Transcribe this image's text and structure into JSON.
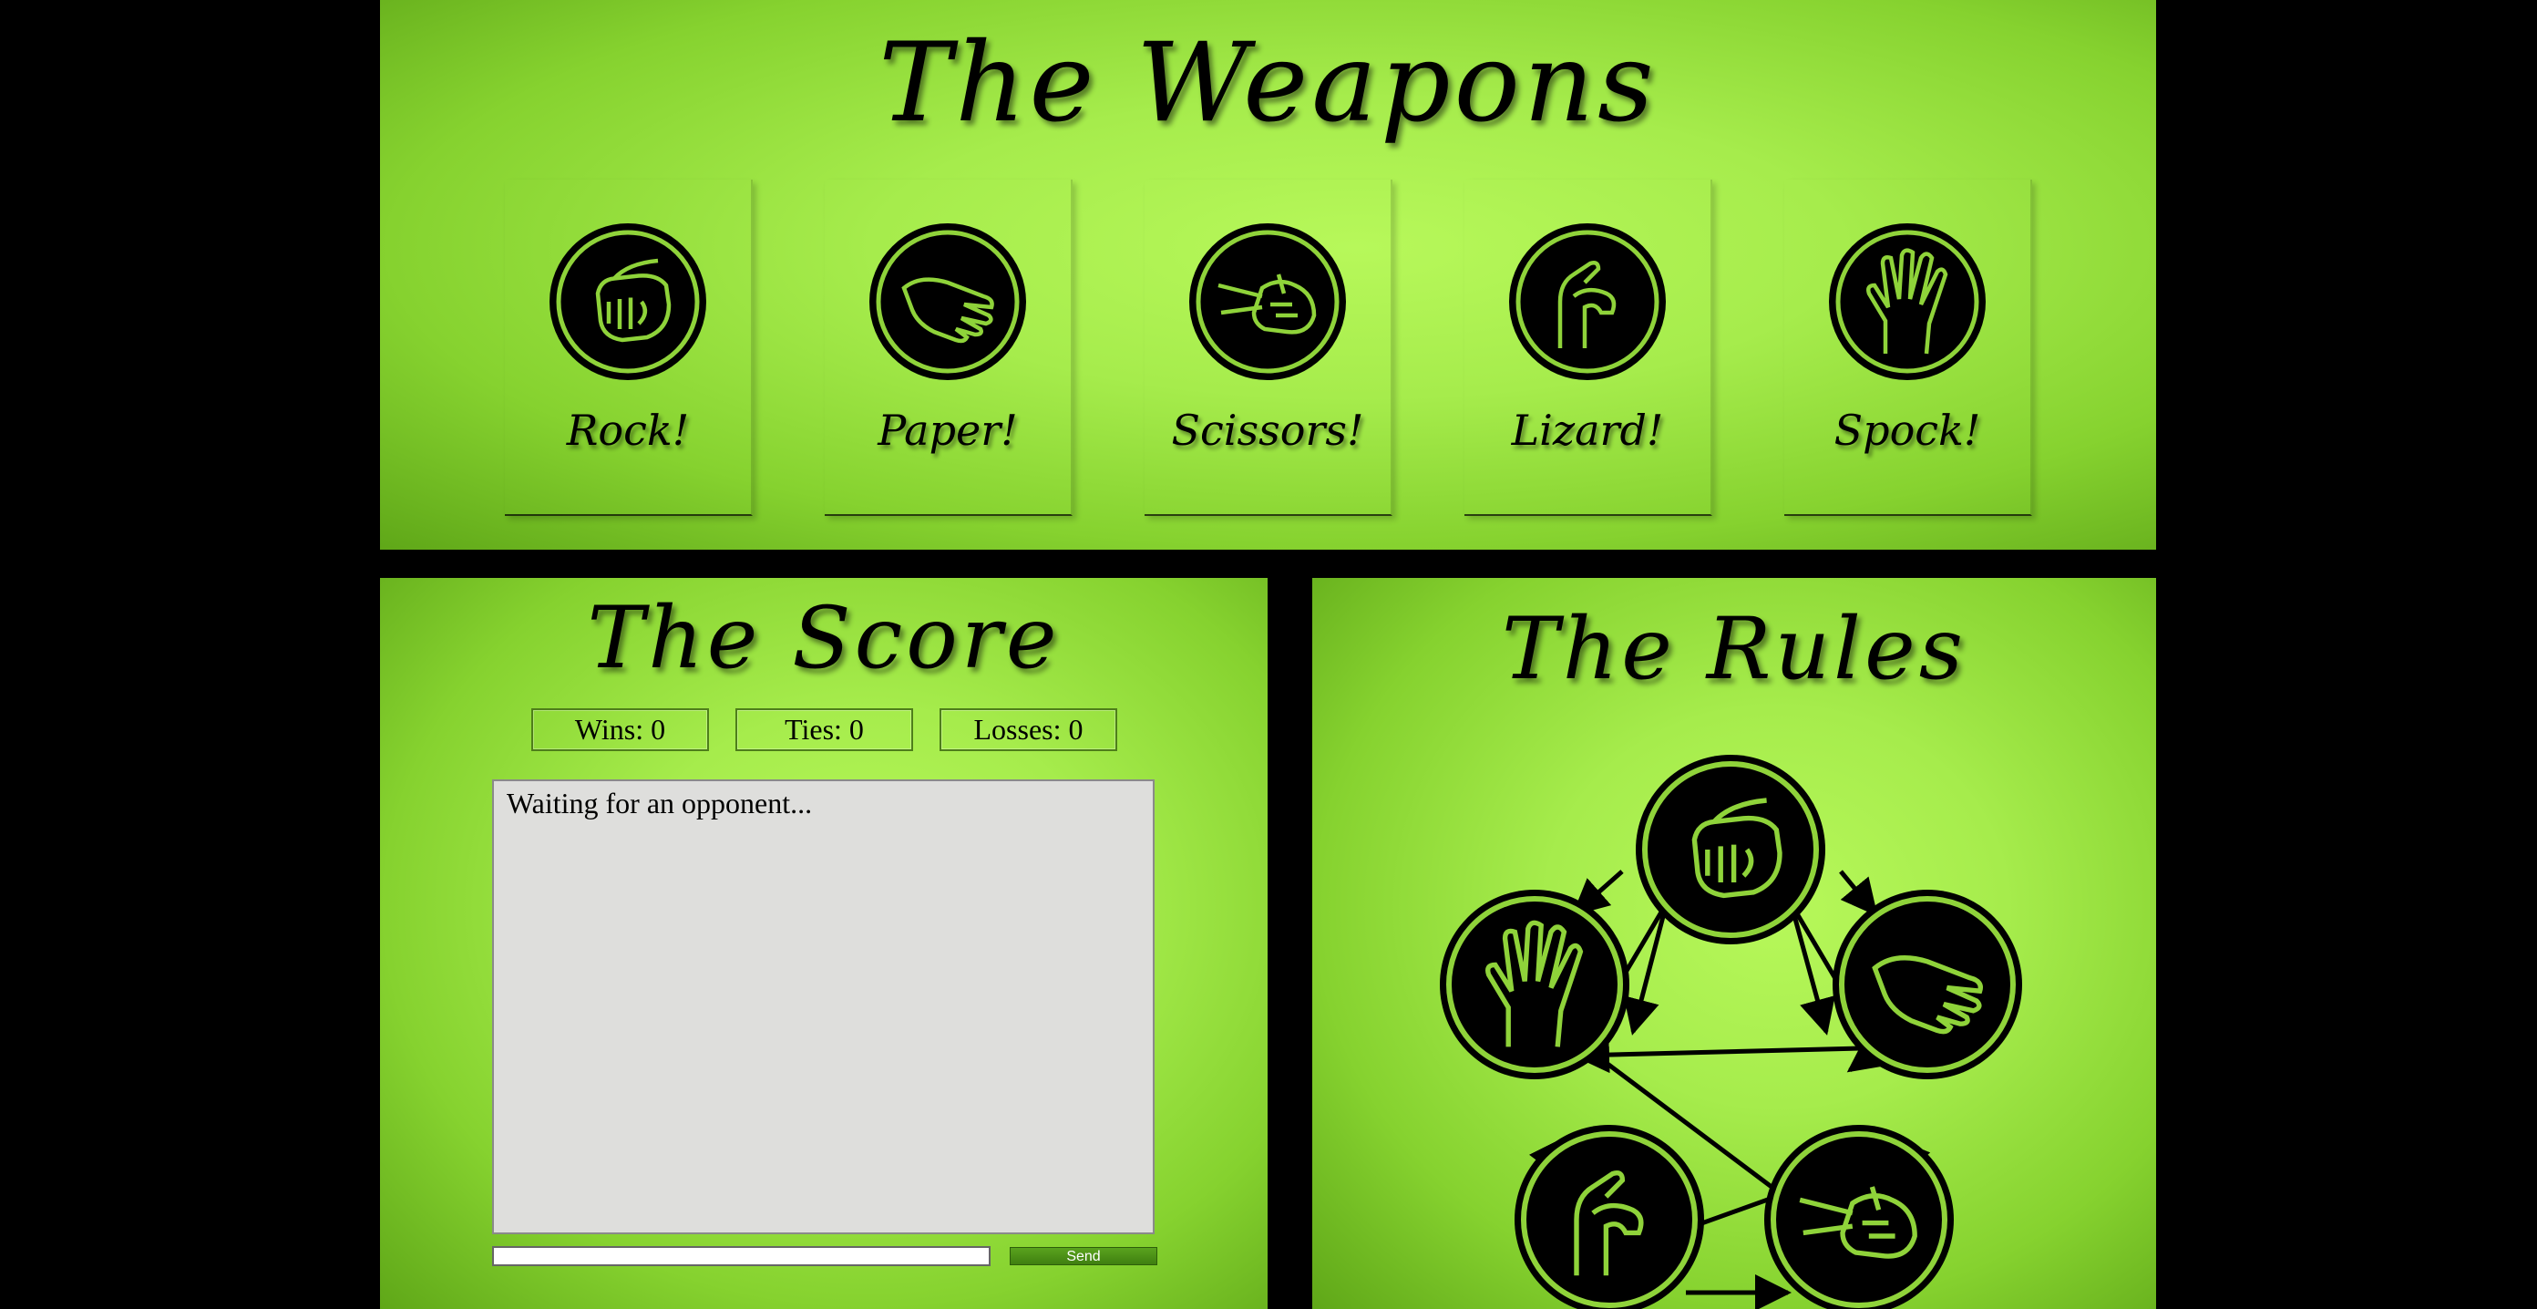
{
  "weapons": {
    "title": "The Weapons",
    "items": [
      {
        "label": "Rock!",
        "icon": "rock-hand-icon"
      },
      {
        "label": "Paper!",
        "icon": "paper-hand-icon"
      },
      {
        "label": "Scissors!",
        "icon": "scissors-hand-icon"
      },
      {
        "label": "Lizard!",
        "icon": "lizard-hand-icon"
      },
      {
        "label": "Spock!",
        "icon": "spock-hand-icon"
      }
    ]
  },
  "score": {
    "title": "The Score",
    "wins": "Wins: 0",
    "ties": "Ties: 0",
    "losses": "Losses: 0",
    "log_text": "Waiting for an opponent...",
    "input_value": "",
    "send_label": "Send"
  },
  "rules": {
    "title": "The Rules",
    "diagram": "rules-cycle-diagram"
  },
  "colors": {
    "accent_green": "#a6ec4c",
    "dark_green": "#5fa718",
    "icon_fill": "#8fd33a",
    "background": "#000000"
  }
}
